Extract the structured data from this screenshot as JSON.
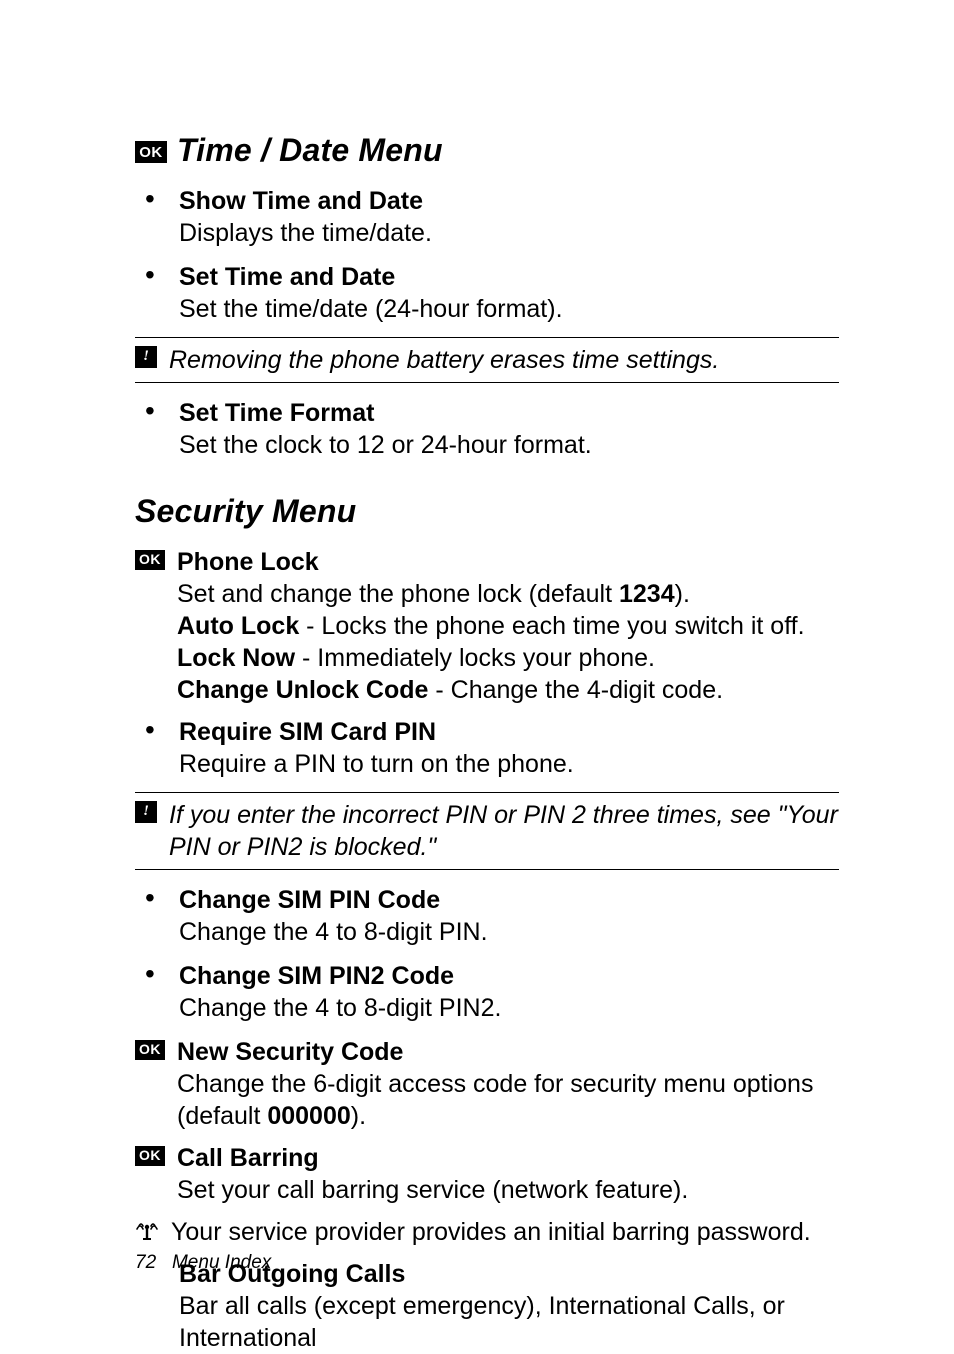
{
  "icons": {
    "ok": "OK",
    "alert": "!"
  },
  "section1": {
    "title": "Time / Date Menu",
    "items": [
      {
        "title": "Show Time and Date",
        "desc": "Displays the time/date."
      },
      {
        "title": "Set Time and Date",
        "desc": "Set the time/date (24-hour format)."
      }
    ],
    "note": "Removing the phone battery erases time settings.",
    "items2": [
      {
        "title": "Set Time Format",
        "desc": "Set the clock to 12 or 24-hour format."
      }
    ]
  },
  "section2": {
    "title": "Security Menu",
    "phoneLock": {
      "title": "Phone Lock",
      "line1a": "Set and change the phone lock (default ",
      "line1b": "1234",
      "line1c": ").",
      "autoLockLabel": "Auto Lock",
      "autoLockDesc": " - Locks the phone each time you switch it off.",
      "lockNowLabel": "Lock Now",
      "lockNowDesc": " -  Immediately locks your phone.",
      "changeCodeLabel": "Change Unlock Code",
      "changeCodeDesc": " - Change the 4-digit code."
    },
    "requireSim": {
      "title": "Require SIM Card PIN",
      "desc": "Require a PIN to turn on the phone."
    },
    "note": "If you enter the incorrect PIN or PIN 2 three times, see \"Your PIN or PIN2 is blocked.\"",
    "changePin": {
      "title": "Change SIM PIN Code",
      "desc": "Change the 4 to 8-digit PIN."
    },
    "changePin2": {
      "title": "Change SIM PIN2 Code",
      "desc": "Change the 4 to 8-digit PIN2."
    },
    "newSec": {
      "title": "New Security Code",
      "desc1": "Change the 6-digit access code for security menu options (default ",
      "desc1b": "000000",
      "desc1c": ")."
    },
    "callBarring": {
      "title": "Call Barring",
      "desc": "Set your call barring service (network feature)."
    },
    "networkNote": "Your service provider provides an initial barring password.",
    "barOutgoing": {
      "title": "Bar Outgoing Calls",
      "desc": "Bar all calls (except emergency), International Calls, or International"
    }
  },
  "footer": {
    "page": "72",
    "label": "Menu Index"
  }
}
